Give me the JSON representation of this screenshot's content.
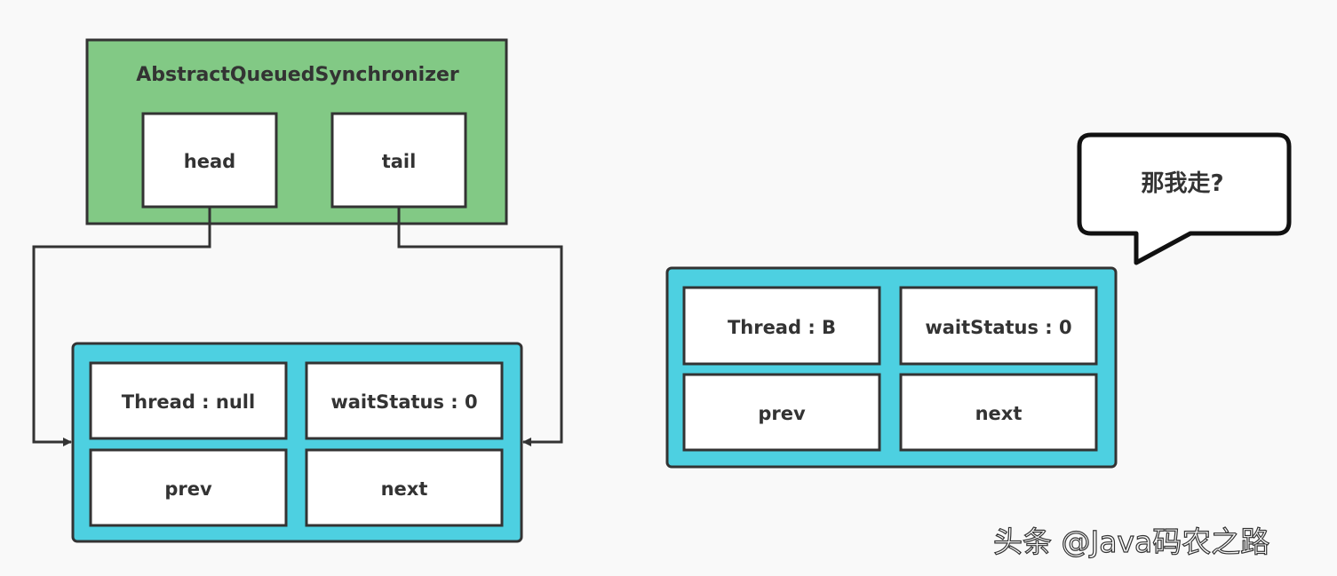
{
  "colors": {
    "background": "#f9f9f9",
    "aqs_fill": "#82c985",
    "node_fill": "#4dd0e1",
    "stroke": "#333333"
  },
  "aqs": {
    "title": "AbstractQueuedSynchronizer",
    "head": "head",
    "tail": "tail"
  },
  "node1": {
    "thread": "Thread : null",
    "wait_status": "waitStatus : 0",
    "prev": "prev",
    "next": "next"
  },
  "node2": {
    "thread": "Thread : B",
    "wait_status": "waitStatus : 0",
    "prev": "prev",
    "next": "next"
  },
  "speech_bubble": {
    "text": "那我走?"
  },
  "watermark": "头条 @Java码农之路"
}
